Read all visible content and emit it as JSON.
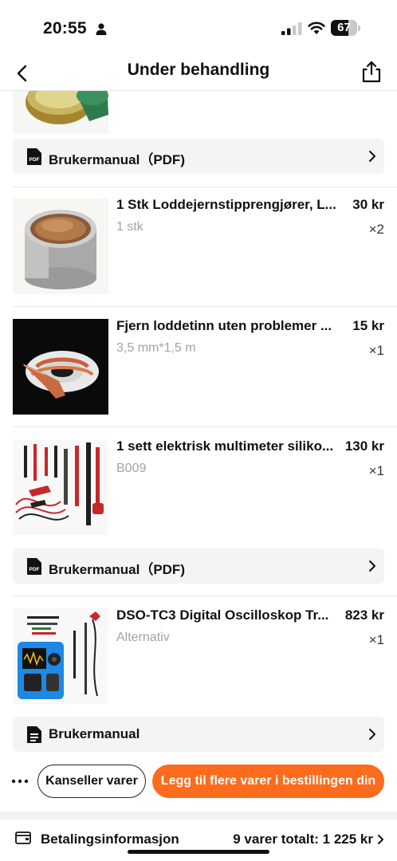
{
  "status_bar": {
    "time": "20:55",
    "battery": "67",
    "battery_level": 0.67
  },
  "nav": {
    "title": "Under behandling"
  },
  "manuals": [
    {
      "label": "Brukermanual（PDF)"
    },
    {
      "label": "Brukermanual（PDF)"
    },
    {
      "label": "Brukermanual"
    }
  ],
  "items": [
    {
      "title": "1 Stk Loddejernstipprengjører, L...",
      "price": "30 kr",
      "variant": "1 stk",
      "qty": "×2"
    },
    {
      "title": "Fjern loddetinn uten problemer ...",
      "price": "15 kr",
      "variant": "3,5 mm*1,5 m",
      "qty": "×1"
    },
    {
      "title": "1 sett elektrisk multimeter siliko...",
      "price": "130 kr",
      "variant": "B009",
      "qty": "×1"
    },
    {
      "title": "DSO-TC3 Digital Oscilloskop Tr...",
      "price": "823 kr",
      "variant": "Alternativ",
      "qty": "×1"
    }
  ],
  "actions": {
    "cancel": "Kanseller varer",
    "add_more": "Legg til flere varer i bestillingen din"
  },
  "payment": {
    "label": "Betalingsinformasjon",
    "total": "9 varer totalt: 1 225 kr"
  },
  "colors": {
    "accent": "#fd6c1c",
    "muted_text": "#a3a3a3",
    "row_bg": "#f4f4f4"
  }
}
